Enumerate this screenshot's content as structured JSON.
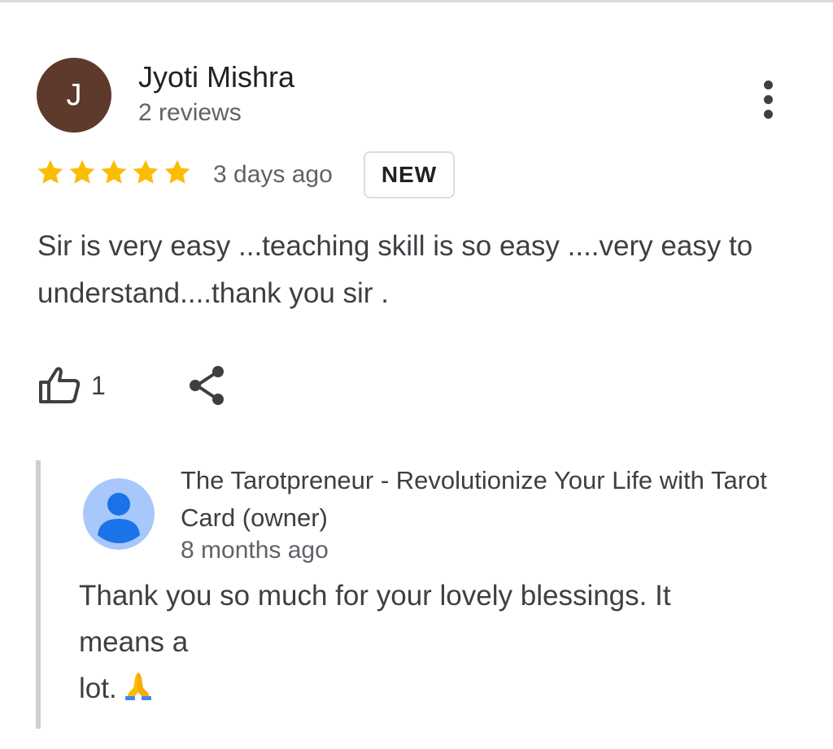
{
  "review": {
    "author_initial": "J",
    "author_name": "Jyoti Mishra",
    "review_count": "2 reviews",
    "rating": 5,
    "star_color": "#fbbc04",
    "time": "3 days ago",
    "badge": "NEW",
    "text": "Sir is very easy ...teaching skill is so easy ....very easy to understand....thank you sir .",
    "likes": "1",
    "avatar_color": "#5d3a2c",
    "icons": {
      "more": "more-vert-icon",
      "like": "thumbs-up-icon",
      "share": "share-icon"
    }
  },
  "owner_reply": {
    "owner_name": "The Tarotpreneur - Revolutionize Your Life with Tarot Card (owner)",
    "time": "8 months ago",
    "text_lines": [
      "Thank you so much for your lovely blessings. It",
      "means a",
      "lot."
    ],
    "emoji": "folded-hands-emoji",
    "avatar_icon": "default-person-icon",
    "avatar_color": "#a8c7fa"
  }
}
